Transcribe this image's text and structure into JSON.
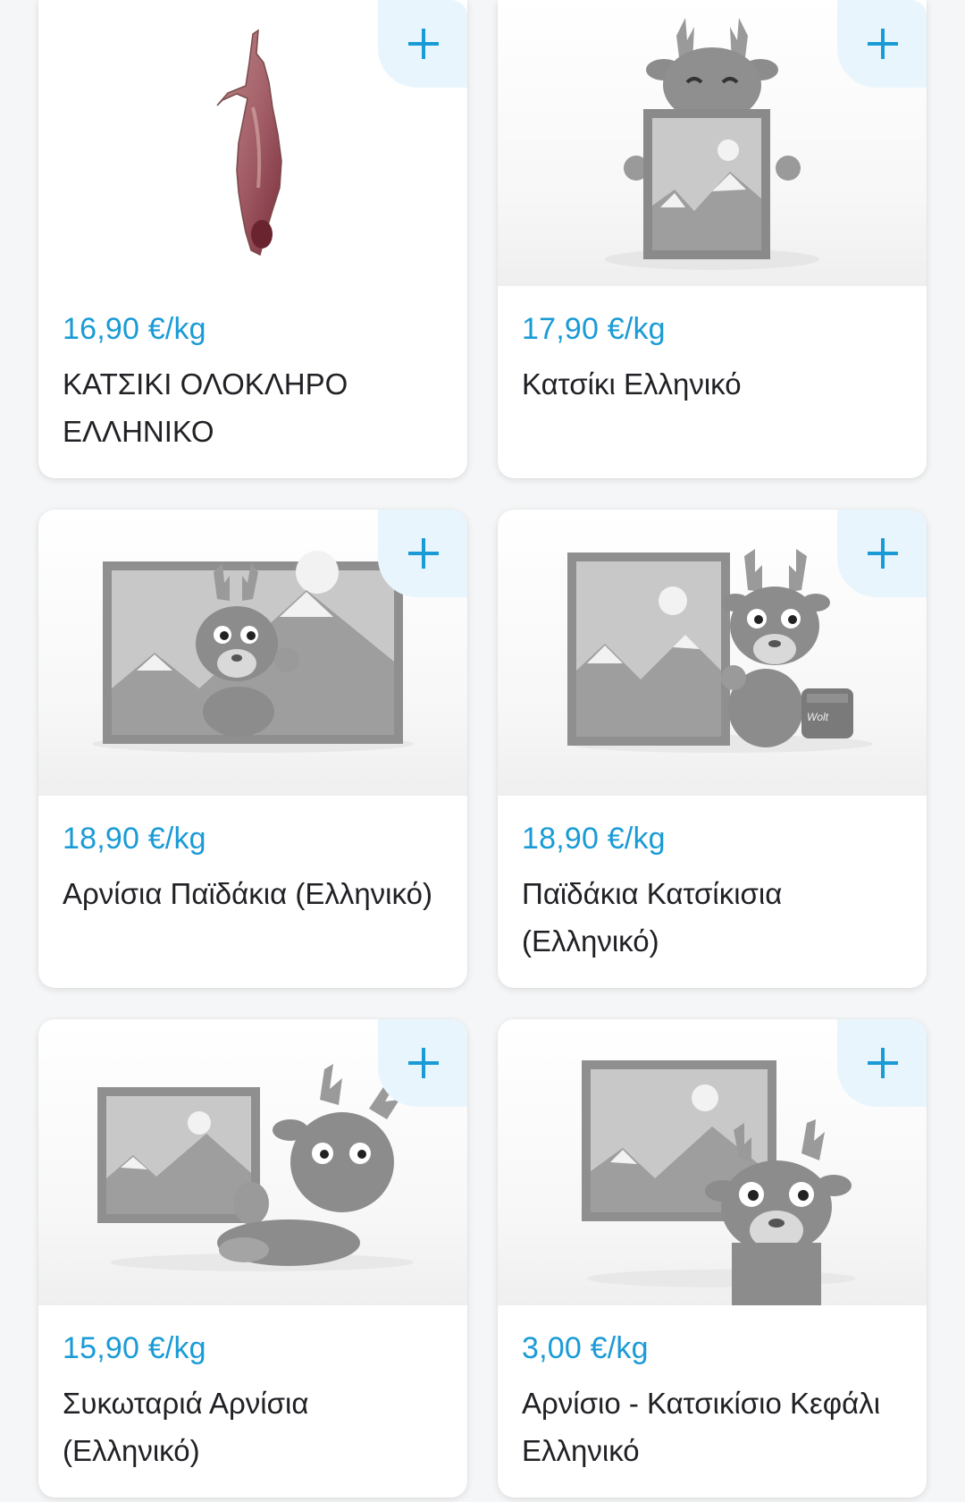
{
  "colors": {
    "accent": "#1a9bd6",
    "add_button_bg": "#e9f5fc",
    "card_bg": "#ffffff",
    "page_bg": "#f5f6f7",
    "text": "#202125"
  },
  "add_icon": "plus-icon",
  "products": [
    {
      "price": "16,90 €/kg",
      "name": "ΚΑΤΣΙΚΙ ΟΛΟΚΛΗΡΟ ΕΛΛΗΝΙΚΟ",
      "image": "whole-goat-carcass-photo"
    },
    {
      "price": "17,90 €/kg",
      "name": "Κατσίκι Ελληνικό",
      "image": "placeholder-mascot-holding-frame"
    },
    {
      "price": "18,90 €/kg",
      "name": "Αρνίσια Παϊδάκια (Ελληνικό)",
      "image": "placeholder-mascot-in-frame"
    },
    {
      "price": "18,90 €/kg",
      "name": "Παϊδάκια Κατσίκισια (Ελληνικό)",
      "image": "placeholder-mascot-beside-frame"
    },
    {
      "price": "15,90 €/kg",
      "name": "Συκωταριά Αρνίσια (Ελληνικό)",
      "image": "placeholder-mascot-lying"
    },
    {
      "price": "3,00 €/kg",
      "name": "Αρνίσιο - Κατσικίσιο Κεφάλι Ελληνικό",
      "image": "placeholder-mascot-below-frame"
    }
  ]
}
